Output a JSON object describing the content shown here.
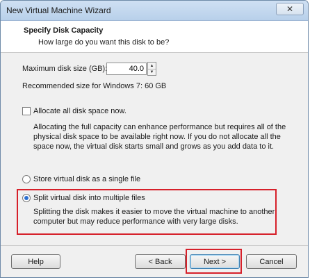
{
  "window": {
    "title": "New Virtual Machine Wizard",
    "close_glyph": "✕"
  },
  "header": {
    "title": "Specify Disk Capacity",
    "subtitle": "How large do you want this disk to be?"
  },
  "disk_size": {
    "label": "Maximum disk size (GB):",
    "value": "40.0"
  },
  "recommended": "Recommended size for Windows 7: 60 GB",
  "allocate": {
    "label": "Allocate all disk space now.",
    "checked": false,
    "description": "Allocating the full capacity can enhance performance but requires all of the physical disk space to be available right now. If you do not allocate all the space now, the virtual disk starts small and grows as you add data to it."
  },
  "single_file": {
    "label": "Store virtual disk as a single file",
    "selected": false
  },
  "split": {
    "label": "Split virtual disk into multiple files",
    "selected": true,
    "description": "Splitting the disk makes it easier to move the virtual machine to another computer but may reduce performance with very large disks."
  },
  "buttons": {
    "help": "Help",
    "back": "< Back",
    "next": "Next >",
    "cancel": "Cancel"
  },
  "colors": {
    "highlight": "#d6202a",
    "radio_dot": "#2b6fd1"
  }
}
